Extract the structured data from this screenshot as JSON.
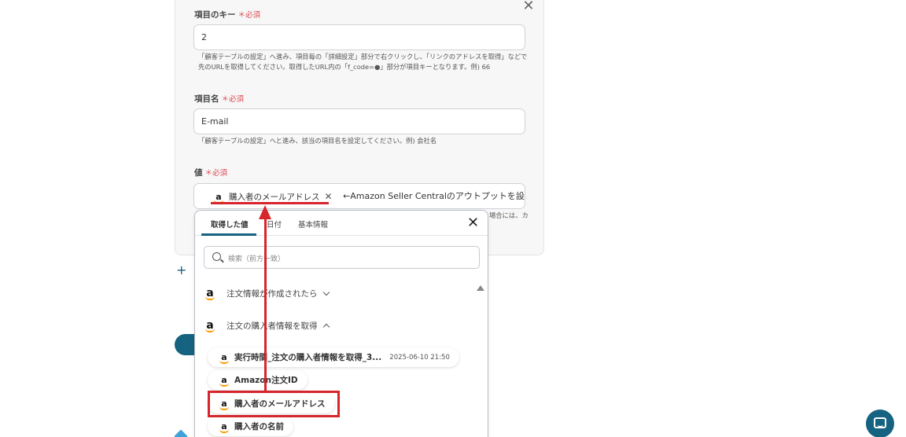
{
  "form": {
    "key_field": {
      "label": "項目のキー",
      "required": "＊必須",
      "value": "2",
      "hint_line1": "「顧客テーブルの設定」へ進み、項目毎の「詳細設定」部分で右クリックし、「リンクのアドレスを取得」などでリンク",
      "hint_line2": "先のURLを取得してください。取得したURL内の「f_code=●」部分が項目キーとなります。例) 66"
    },
    "name_field": {
      "label": "項目名",
      "required": "＊必須",
      "value": "E-mail",
      "hint": "「顧客テーブルの設定」へと進み、該当の項目名を設定してください。例) 会社名"
    },
    "value_field": {
      "label": "値",
      "required": "＊必須",
      "chip_label": "購入者のメールアドレス",
      "trailing_text": "←Amazon Seller Centralのアウトプットを設定し",
      "hint_fragment": "場合には、カ"
    },
    "add_label": "+"
  },
  "dropdown": {
    "tabs": [
      {
        "label": "取得した値",
        "active": true
      },
      {
        "label": "日付",
        "active": false
      },
      {
        "label": "基本情報",
        "active": false
      }
    ],
    "search_placeholder": "検索（前方一致）",
    "groups": [
      {
        "label": "注文情報が作成されたら",
        "expanded": false
      },
      {
        "label": "注文の購入者情報を取得",
        "expanded": true
      }
    ],
    "items": [
      {
        "label": "実行時間_注文の購入者情報を取得_3...",
        "timestamp": "2025-06-10 21:50"
      },
      {
        "label": "Amazon注文ID"
      },
      {
        "label": "購入者のメールアドレス",
        "highlighted": true
      },
      {
        "label": "購入者の名前"
      }
    ],
    "amazon_icon_glyph": "a"
  },
  "colors": {
    "accent": "#156281",
    "required": "#e0474c",
    "annotation": "#d6262b",
    "amazon_orange": "#ff9900"
  }
}
